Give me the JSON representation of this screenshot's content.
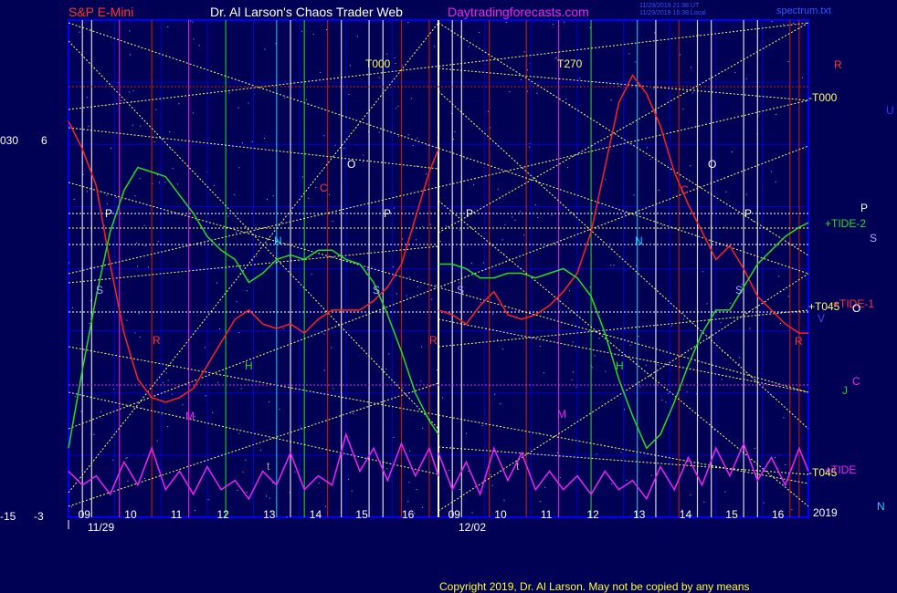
{
  "header": {
    "left_title": "S&P E-Mini",
    "center_title": "Dr. Al Larson's Chaos Trader Web",
    "site": "Daytradingforecasts.com",
    "timestamp_1": "11/29/2019 21:38 UT",
    "timestamp_2": "11/29/2019 16:38 Local",
    "spectrum_file": "spectrum.txt"
  },
  "footer": {
    "copyright": "Copyright 2019, Dr. Al Larson. May not be copied by any means"
  },
  "colors": {
    "background": "#000055",
    "plot_border": "#0000ff",
    "sp_line": "#ff2020",
    "tide_line": "#22dd22",
    "spectrum_line": "#ee22ee",
    "eclipse_line": "#ffff66"
  },
  "chart_data": {
    "type": "line",
    "title": "S&P E-Mini",
    "left_axis_ticks": [
      {
        "label": "030",
        "value": 6
      },
      {
        "label": "6",
        "value": 6
      },
      {
        "label": "-15",
        "value": -3
      },
      {
        "label": "-3",
        "value": -3
      }
    ],
    "date_labels": [
      "11/29",
      "12/02"
    ],
    "hour_labels": [
      "09",
      "10",
      "11",
      "12",
      "13",
      "14",
      "15",
      "16",
      "09",
      "10",
      "11",
      "12",
      "13",
      "14",
      "15",
      "16"
    ],
    "year_label": "2019",
    "right_labels": [
      {
        "text": "R",
        "color": "#ff3333"
      },
      {
        "text": "-T000",
        "color": "#ffff66"
      },
      {
        "text": "U",
        "color": "#3333ff"
      },
      {
        "text": "P",
        "color": "#ffffff"
      },
      {
        "text": "+TIDE-2",
        "color": "#22dd22"
      },
      {
        "text": "S",
        "color": "#aaaaff"
      },
      {
        "text": "+T045",
        "color": "#ffff66"
      },
      {
        "text": "+TIDE-1",
        "color": "#ff3333"
      },
      {
        "text": "O",
        "color": "#ffffff"
      },
      {
        "text": "V",
        "color": "#4444ff"
      },
      {
        "text": "R",
        "color": "#ff3333"
      },
      {
        "text": "C",
        "color": "#ee22ee"
      },
      {
        "text": "J",
        "color": "#22dd22"
      },
      {
        "text": "-T045",
        "color": "#ffff66"
      },
      {
        "text": "+TIDE",
        "color": "#ee22ee"
      },
      {
        "text": "N",
        "color": "#22ccff"
      }
    ],
    "eclipse_labels": [
      "T000",
      "T270"
    ],
    "planet_labels": [
      {
        "text": "P",
        "color": "#ffffff"
      },
      {
        "text": "S",
        "color": "#aaaaff"
      },
      {
        "text": "R",
        "color": "#ff3333"
      },
      {
        "text": "M",
        "color": "#ee22ee"
      },
      {
        "text": "H",
        "color": "#22dd22"
      },
      {
        "text": "N",
        "color": "#22ccff"
      },
      {
        "text": "t",
        "color": "#aaaaaa"
      },
      {
        "text": "O",
        "color": "#ffffff"
      },
      {
        "text": "C",
        "color": "#ff3333"
      },
      {
        "text": "P",
        "color": "#ffffff"
      },
      {
        "text": "S",
        "color": "#aaaaff"
      },
      {
        "text": "P",
        "color": "#ffffff"
      },
      {
        "text": "S",
        "color": "#aaaaff"
      },
      {
        "text": "R",
        "color": "#ff3333"
      },
      {
        "text": "M",
        "color": "#ee22ee"
      },
      {
        "text": "H",
        "color": "#22dd22"
      },
      {
        "text": "N",
        "color": "#22ccff"
      },
      {
        "text": "t",
        "color": "#aaaaaa"
      },
      {
        "text": "O",
        "color": "#ffffff"
      },
      {
        "text": "C",
        "color": "#ff3333"
      },
      {
        "text": "P",
        "color": "#ffffff"
      },
      {
        "text": "S",
        "color": "#aaaaff"
      }
    ],
    "series": [
      {
        "name": "S&P E-Mini",
        "color": "#ff2020",
        "segment": 1,
        "x": [
          0,
          0.3,
          0.6,
          0.9,
          1.2,
          1.5,
          1.8,
          2.1,
          2.4,
          2.7,
          3.0,
          3.3,
          3.6,
          3.9,
          4.2,
          4.5,
          4.8,
          5.1,
          5.4,
          5.7,
          6.0,
          6.3,
          6.6,
          6.9,
          7.2,
          7.5,
          7.8,
          8.0
        ],
        "y": [
          5.6,
          5.0,
          4.2,
          2.5,
          1.0,
          0.0,
          -0.4,
          -0.5,
          -0.4,
          -0.2,
          0.3,
          0.8,
          1.3,
          1.5,
          1.2,
          1.1,
          1.2,
          1.0,
          1.3,
          1.5,
          1.5,
          1.5,
          1.7,
          2.0,
          2.5,
          3.5,
          4.5,
          5.0
        ]
      },
      {
        "name": "S&P E-Mini",
        "color": "#ff2020",
        "segment": 2,
        "x": [
          8.0,
          8.3,
          8.6,
          8.9,
          9.2,
          9.5,
          9.8,
          10.1,
          10.4,
          10.7,
          11.0,
          11.3,
          11.6,
          11.9,
          12.2,
          12.5,
          12.8,
          13.1,
          13.4,
          13.7,
          14.0,
          14.3,
          14.6,
          14.9,
          15.2,
          15.5,
          15.8,
          16.0
        ],
        "y": [
          1.5,
          1.4,
          1.2,
          1.6,
          1.9,
          1.4,
          1.3,
          1.4,
          1.6,
          1.9,
          2.3,
          3.2,
          4.6,
          6.0,
          6.6,
          6.2,
          5.5,
          4.5,
          3.8,
          3.2,
          2.6,
          2.9,
          2.4,
          1.8,
          1.5,
          1.2,
          1.0,
          1.0
        ]
      },
      {
        "name": "+TIDE-2",
        "color": "#22dd22",
        "segment": 1,
        "x": [
          0,
          0.3,
          0.6,
          0.9,
          1.2,
          1.5,
          1.8,
          2.1,
          2.4,
          2.7,
          3.0,
          3.3,
          3.6,
          3.9,
          4.2,
          4.5,
          4.8,
          5.1,
          5.4,
          5.7,
          6.0,
          6.3,
          6.6,
          6.9,
          7.2,
          7.5,
          7.8,
          8.0
        ],
        "y": [
          -1.5,
          0.2,
          1.8,
          3.2,
          4.1,
          4.6,
          4.5,
          4.4,
          4.0,
          3.6,
          3.1,
          2.8,
          2.6,
          2.1,
          2.3,
          2.6,
          2.7,
          2.6,
          2.8,
          2.8,
          2.6,
          2.5,
          2.1,
          1.4,
          0.6,
          -0.3,
          -0.9,
          -1.2
        ]
      },
      {
        "name": "+TIDE-2",
        "color": "#22dd22",
        "segment": 2,
        "x": [
          8.0,
          8.3,
          8.6,
          8.9,
          9.2,
          9.5,
          9.8,
          10.1,
          10.4,
          10.7,
          11.0,
          11.3,
          11.6,
          11.9,
          12.2,
          12.5,
          12.8,
          13.1,
          13.4,
          13.7,
          14.0,
          14.3,
          14.6,
          14.9,
          15.2,
          15.5,
          15.8,
          16.0
        ],
        "y": [
          2.5,
          2.5,
          2.4,
          2.2,
          2.2,
          2.3,
          2.3,
          2.2,
          2.3,
          2.4,
          2.2,
          1.8,
          1.0,
          0.0,
          -0.8,
          -1.5,
          -1.2,
          -0.5,
          0.3,
          1.0,
          1.5,
          1.5,
          2.0,
          2.5,
          2.8,
          3.1,
          3.3,
          3.4
        ]
      },
      {
        "name": "+TIDE",
        "color": "#ee22ee",
        "segment": 1,
        "x": [
          0,
          0.3,
          0.6,
          0.9,
          1.2,
          1.5,
          1.8,
          2.1,
          2.4,
          2.7,
          3.0,
          3.3,
          3.6,
          3.9,
          4.2,
          4.5,
          4.8,
          5.1,
          5.4,
          5.7,
          6.0,
          6.3,
          6.6,
          6.9,
          7.2,
          7.5,
          7.8,
          8.0
        ],
        "y": [
          -2.0,
          -2.3,
          -2.1,
          -2.5,
          -1.8,
          -2.3,
          -1.5,
          -2.4,
          -2.0,
          -2.5,
          -1.9,
          -2.4,
          -2.2,
          -2.6,
          -2.0,
          -2.3,
          -1.6,
          -2.4,
          -2.1,
          -2.3,
          -1.2,
          -2.0,
          -1.5,
          -2.2,
          -1.4,
          -2.1,
          -1.5,
          -2.1
        ]
      },
      {
        "name": "+TIDE",
        "color": "#ee22ee",
        "segment": 2,
        "x": [
          8.0,
          8.3,
          8.6,
          8.9,
          9.2,
          9.5,
          9.8,
          10.1,
          10.4,
          10.7,
          11.0,
          11.3,
          11.6,
          11.9,
          12.2,
          12.5,
          12.8,
          13.1,
          13.4,
          13.7,
          14.0,
          14.3,
          14.6,
          14.9,
          15.2,
          15.5,
          15.8,
          16.0
        ],
        "y": [
          -1.6,
          -2.4,
          -1.8,
          -2.5,
          -1.5,
          -2.2,
          -1.6,
          -2.4,
          -2.0,
          -2.4,
          -2.1,
          -2.5,
          -2.0,
          -2.4,
          -2.2,
          -2.6,
          -1.9,
          -2.4,
          -1.7,
          -2.3,
          -1.5,
          -2.1,
          -1.4,
          -2.2,
          -1.7,
          -2.3,
          -1.5,
          -2.0
        ]
      }
    ],
    "xlim": [
      0,
      16
    ],
    "ylim": [
      -3,
      7.8
    ],
    "grid": true
  }
}
